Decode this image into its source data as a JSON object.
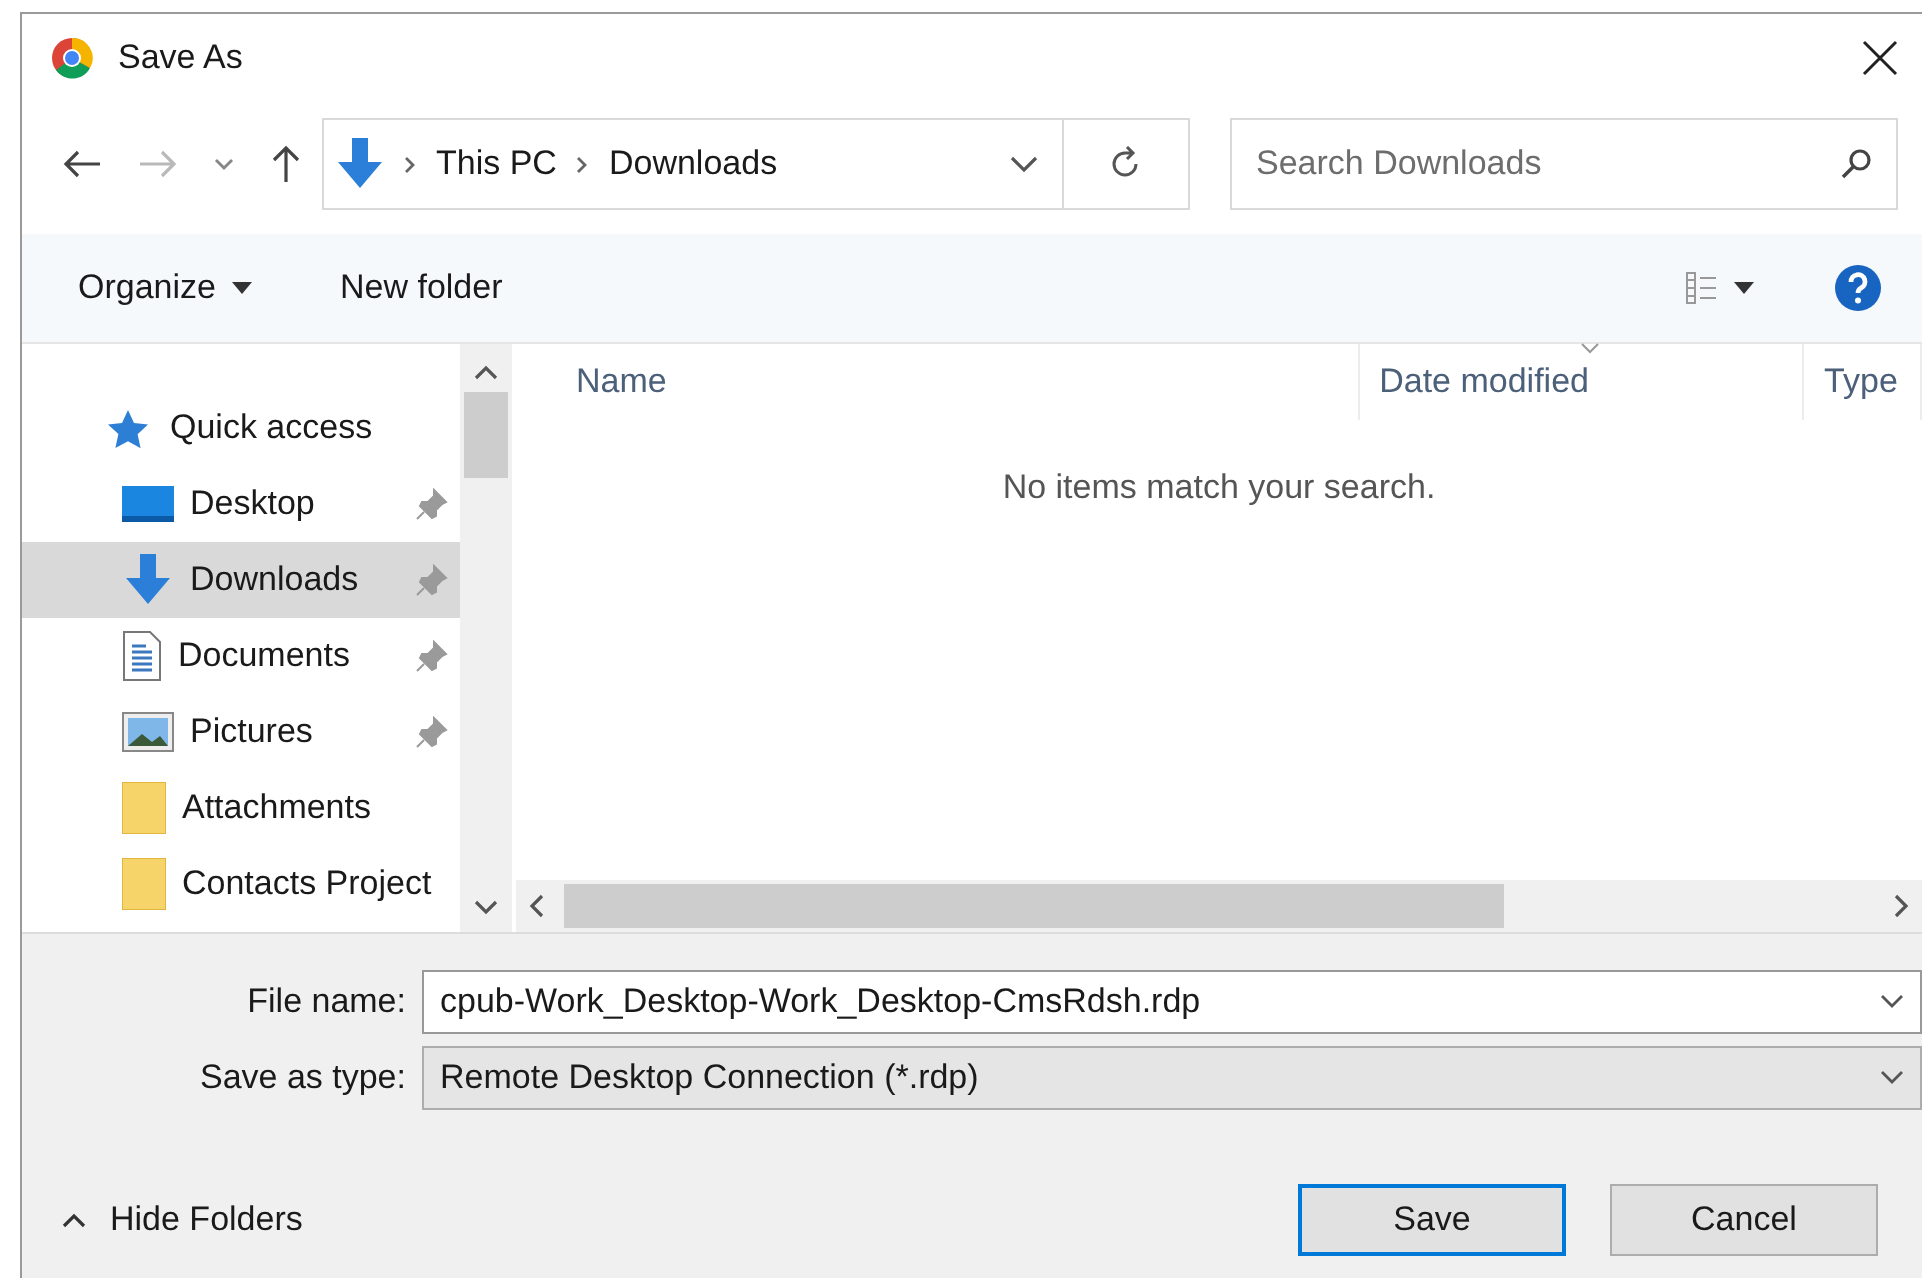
{
  "window": {
    "title": "Save As"
  },
  "address": {
    "breadcrumbs": [
      "This PC",
      "Downloads"
    ]
  },
  "search": {
    "placeholder": "Search Downloads"
  },
  "toolbar": {
    "organize": "Organize",
    "new_folder": "New folder"
  },
  "sidebar": {
    "items": [
      {
        "label": "Quick access",
        "kind": "star",
        "selected": false,
        "children": [
          {
            "label": "Desktop",
            "kind": "desktop",
            "pinned": true,
            "selected": false
          },
          {
            "label": "Downloads",
            "kind": "download",
            "pinned": true,
            "selected": true
          },
          {
            "label": "Documents",
            "kind": "document",
            "pinned": true,
            "selected": false
          },
          {
            "label": "Pictures",
            "kind": "picture",
            "pinned": true,
            "selected": false
          },
          {
            "label": "Attachments",
            "kind": "folder",
            "pinned": false,
            "selected": false
          },
          {
            "label": "Contacts Project",
            "kind": "folder",
            "pinned": false,
            "selected": false
          }
        ]
      }
    ]
  },
  "table": {
    "columns": [
      {
        "label": "Name",
        "sorted": false
      },
      {
        "label": "Date modified",
        "sorted": true
      },
      {
        "label": "Type",
        "sorted": false
      }
    ],
    "empty_message": "No items match your search."
  },
  "file_name": {
    "label": "File name:",
    "value": "cpub-Work_Desktop-Work_Desktop-CmsRdsh.rdp"
  },
  "save_type": {
    "label": "Save as type:",
    "value": "Remote Desktop Connection (*.rdp)"
  },
  "hide_folders": {
    "label": "Hide Folders"
  },
  "buttons": [
    {
      "label": "Save",
      "default": true
    },
    {
      "label": "Cancel",
      "default": false
    }
  ]
}
